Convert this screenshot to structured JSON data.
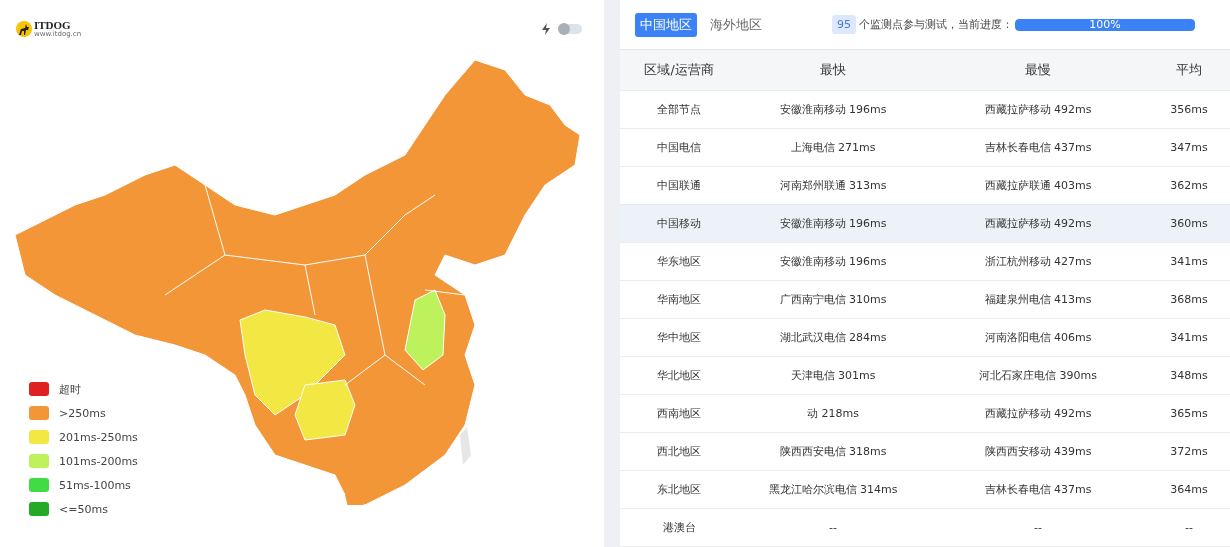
{
  "map_panel": {
    "logo": {
      "name": "ITDOG",
      "url": "www.itdog.cn"
    },
    "toggle": {
      "on": false
    },
    "legend": [
      {
        "label": "超时",
        "color": "#e02020"
      },
      {
        "label": ">250ms",
        "color": "#f39637"
      },
      {
        "label": "201ms-250ms",
        "color": "#f3e843"
      },
      {
        "label": "101ms-200ms",
        "color": "#bdf25c"
      },
      {
        "label": "51ms-100ms",
        "color": "#3fdc45"
      },
      {
        "label": "<=50ms",
        "color": "#25a928"
      }
    ]
  },
  "results_panel": {
    "tabs": [
      {
        "label": "中国地区",
        "selected": true
      },
      {
        "label": "海外地区",
        "selected": false
      }
    ],
    "node_count": "95",
    "progress_label": "个监测点参与测试，当前进度：",
    "progress": {
      "level": 1,
      "text": "100%"
    },
    "table": {
      "columns": [
        "区域/运营商",
        "最快",
        "最慢",
        "平均"
      ],
      "rows": [
        {
          "cells": [
            "全部节点",
            "安徽淮南移动 196ms",
            "西藏拉萨移动 492ms",
            "356ms"
          ],
          "highlighted": false
        },
        {
          "cells": [
            "中国电信",
            "上海电信 271ms",
            "吉林长春电信 437ms",
            "347ms"
          ],
          "highlighted": false
        },
        {
          "cells": [
            "中国联通",
            "河南郑州联通 313ms",
            "西藏拉萨联通 403ms",
            "362ms"
          ],
          "highlighted": false
        },
        {
          "cells": [
            "中国移动",
            "安徽淮南移动 196ms",
            "西藏拉萨移动 492ms",
            "360ms"
          ],
          "highlighted": true
        },
        {
          "cells": [
            "华东地区",
            "安徽淮南移动 196ms",
            "浙江杭州移动 427ms",
            "341ms"
          ],
          "highlighted": false
        },
        {
          "cells": [
            "华南地区",
            "广西南宁电信 310ms",
            "福建泉州电信 413ms",
            "368ms"
          ],
          "highlighted": false
        },
        {
          "cells": [
            "华中地区",
            "湖北武汉电信 284ms",
            "河南洛阳电信 406ms",
            "341ms"
          ],
          "highlighted": false
        },
        {
          "cells": [
            "华北地区",
            "天津电信 301ms",
            "河北石家庄电信 390ms",
            "348ms"
          ],
          "highlighted": false
        },
        {
          "cells": [
            "西南地区",
            "动 218ms",
            "西藏拉萨移动 492ms",
            "365ms"
          ],
          "highlighted": false
        },
        {
          "cells": [
            "西北地区",
            "陕西西安电信 318ms",
            "陕西西安移动 439ms",
            "372ms"
          ],
          "highlighted": false
        },
        {
          "cells": [
            "东北地区",
            "黑龙江哈尔滨电信 314ms",
            "吉林长春电信 437ms",
            "364ms"
          ],
          "highlighted": false
        },
        {
          "cells": [
            "港澳台",
            "--",
            "--",
            "--"
          ],
          "highlighted": false
        }
      ]
    }
  }
}
